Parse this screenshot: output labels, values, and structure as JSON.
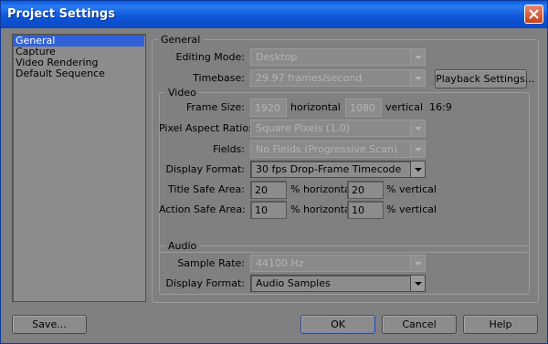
{
  "window": {
    "title": "Project Settings"
  },
  "nav": {
    "items": [
      "General",
      "Capture",
      "Video Rendering",
      "Default Sequence"
    ],
    "selected": "General"
  },
  "general": {
    "legend": "General",
    "editing_mode": {
      "label": "Editing Mode:",
      "value": "Desktop"
    },
    "timebase": {
      "label": "Timebase:",
      "value": "29.97 frames/second"
    },
    "playback_button": "Playback Settings..."
  },
  "video": {
    "legend": "Video",
    "frame_size": {
      "label": "Frame Size:",
      "width": "1920",
      "horizontal": "horizontal",
      "height": "1080",
      "vertical": "vertical",
      "aspect": "16:9"
    },
    "pixel_aspect": {
      "label": "Pixel Aspect Ratio:",
      "value": "Square Pixels (1.0)"
    },
    "fields": {
      "label": "Fields:",
      "value": "No Fields (Progressive Scan)"
    },
    "display_format": {
      "label": "Display Format:",
      "value": "30 fps Drop-Frame Timecode"
    },
    "title_safe": {
      "label": "Title Safe Area:",
      "h_value": "20",
      "h_unit": "% horizontal",
      "v_value": "20",
      "v_unit": "% vertical"
    },
    "action_safe": {
      "label": "Action Safe Area:",
      "h_value": "10",
      "h_unit": "% horizontal",
      "v_value": "10",
      "v_unit": "% vertical"
    }
  },
  "audio": {
    "legend": "Audio",
    "sample_rate": {
      "label": "Sample Rate:",
      "value": "44100 Hz"
    },
    "display_format": {
      "label": "Display Format:",
      "value": "Audio Samples"
    }
  },
  "footer": {
    "save": "Save...",
    "ok": "OK",
    "cancel": "Cancel",
    "help": "Help"
  },
  "colors": {
    "titlebar": "#0a5ae0",
    "selection": "#3162d8",
    "dialog_bg": "#808080"
  },
  "icons": {
    "close": "close-icon"
  }
}
